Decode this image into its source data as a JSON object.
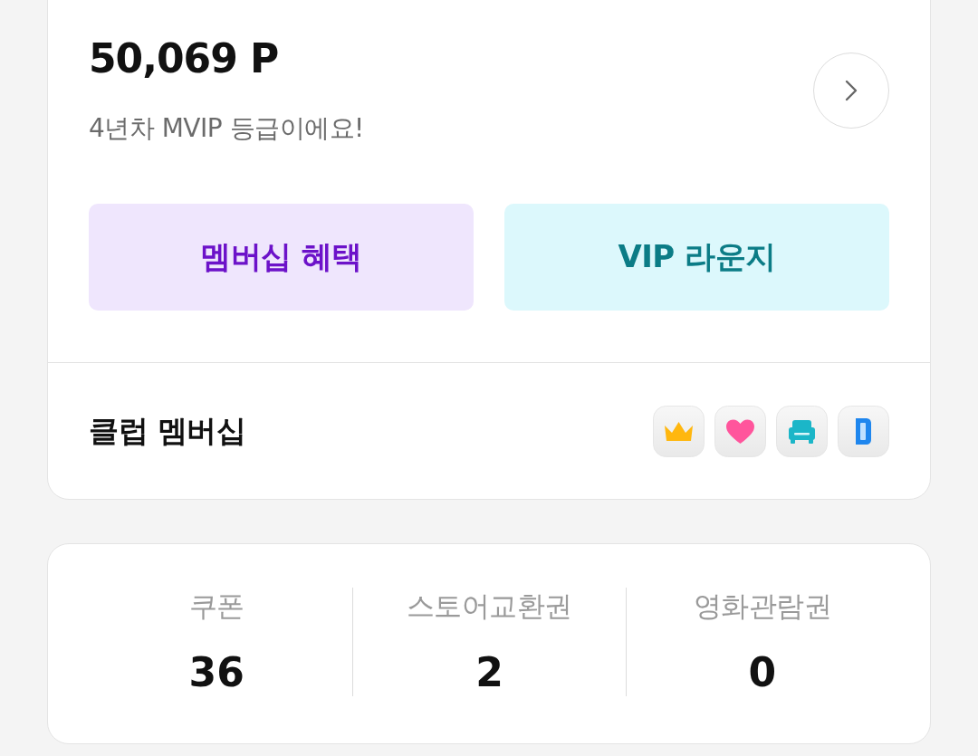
{
  "points_card": {
    "points": "50,069 P",
    "grade_message": "4년차 MVIP 등급이에요!",
    "actions": [
      {
        "kind": "membership",
        "label": "멤버십 혜택"
      },
      {
        "kind": "lounge",
        "label": "VIP 라운지"
      }
    ],
    "club": {
      "title": "클럽 멤버십"
    }
  },
  "benefits": [
    {
      "label": "쿠폰",
      "count": "36"
    },
    {
      "label": "스토어교환권",
      "count": "2"
    },
    {
      "label": "영화관람권",
      "count": "0"
    }
  ]
}
